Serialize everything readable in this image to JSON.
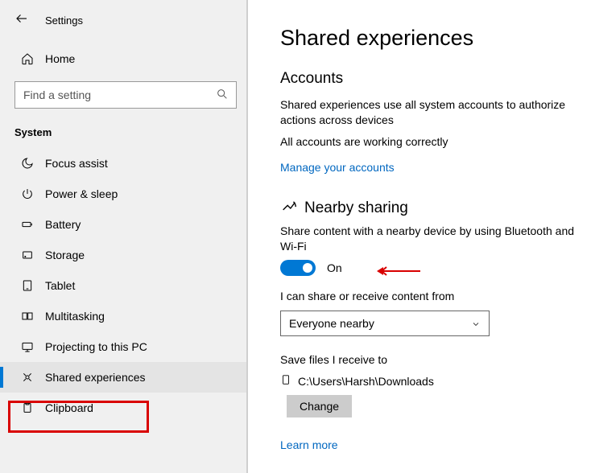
{
  "window": {
    "title": "Settings"
  },
  "sidebar": {
    "home": "Home",
    "search_placeholder": "Find a setting",
    "section_label": "System",
    "items": [
      {
        "label": "Focus assist"
      },
      {
        "label": "Power & sleep"
      },
      {
        "label": "Battery"
      },
      {
        "label": "Storage"
      },
      {
        "label": "Tablet"
      },
      {
        "label": "Multitasking"
      },
      {
        "label": "Projecting to this PC"
      },
      {
        "label": "Shared experiences"
      },
      {
        "label": "Clipboard"
      }
    ]
  },
  "main": {
    "title": "Shared experiences",
    "accounts": {
      "heading": "Accounts",
      "body": "Shared experiences use all system accounts to authorize actions across devices",
      "status": "All accounts are working correctly",
      "link": "Manage your accounts"
    },
    "nearby": {
      "heading": "Nearby sharing",
      "desc": "Share content with a nearby device by using Bluetooth and Wi-Fi",
      "toggle_label": "On",
      "receive_label": "I can share or receive content from",
      "dropdown_value": "Everyone nearby",
      "save_label": "Save files I receive to",
      "save_path": "C:\\Users\\Harsh\\Downloads",
      "change_btn": "Change",
      "learn_more": "Learn more"
    }
  }
}
